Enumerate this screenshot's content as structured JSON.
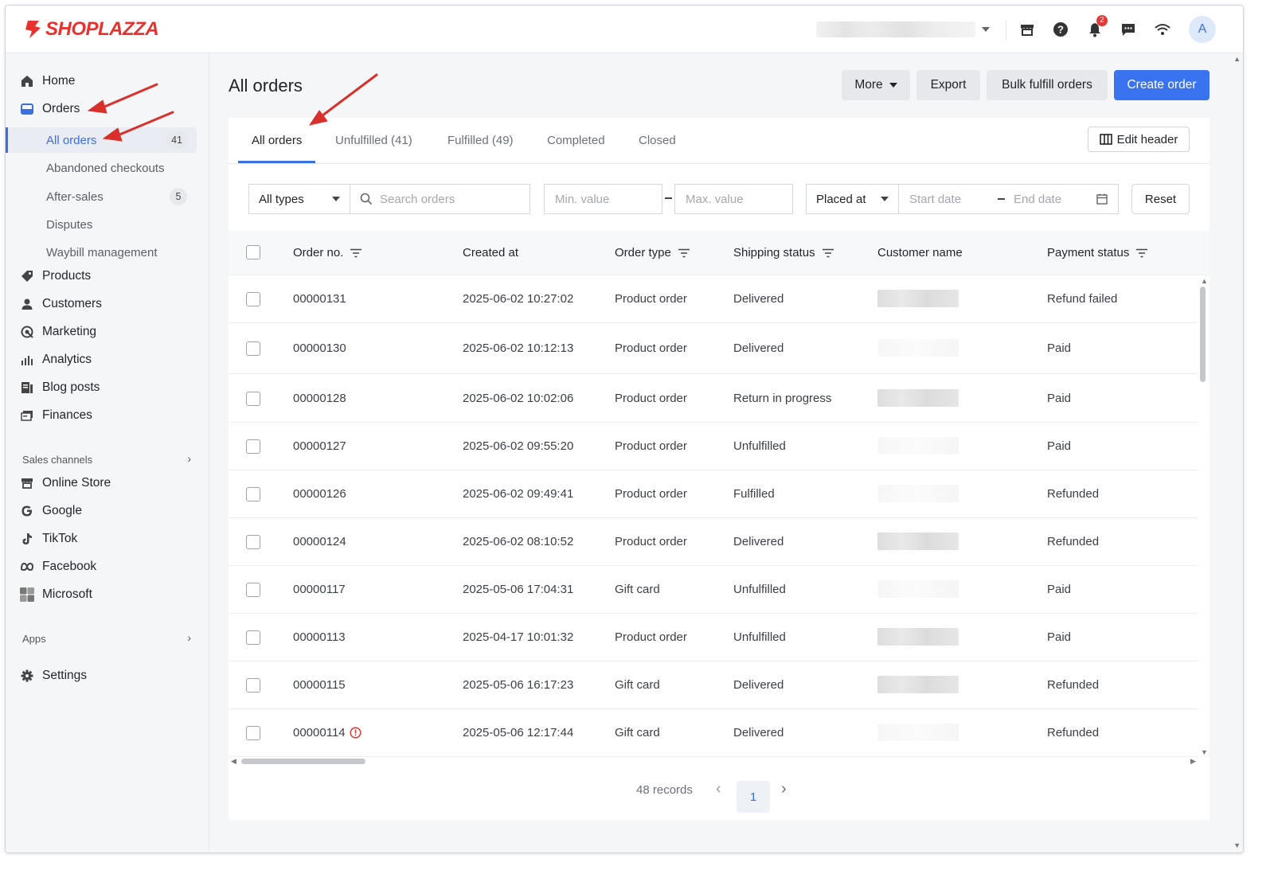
{
  "brand": {
    "name": "SHOPLAZZA",
    "accent": "#e8322e",
    "primary": "#3a73f0"
  },
  "topbar": {
    "notification_count": "2",
    "avatar_letter": "A",
    "icons": [
      "store-icon",
      "help-icon",
      "bell-icon",
      "chat-icon",
      "wifi-icon"
    ]
  },
  "sidebar": {
    "items": [
      {
        "label": "Home",
        "icon": "home-icon"
      },
      {
        "label": "Orders",
        "icon": "orders-icon"
      },
      {
        "label": "Products",
        "icon": "tag-icon"
      },
      {
        "label": "Customers",
        "icon": "person-icon"
      },
      {
        "label": "Marketing",
        "icon": "marketing-icon"
      },
      {
        "label": "Analytics",
        "icon": "bar-chart-icon"
      },
      {
        "label": "Blog posts",
        "icon": "blog-icon"
      },
      {
        "label": "Finances",
        "icon": "finance-icon"
      }
    ],
    "orders_sub": [
      {
        "label": "All orders",
        "count": "41"
      },
      {
        "label": "Abandoned checkouts"
      },
      {
        "label": "After-sales",
        "count": "5"
      },
      {
        "label": "Disputes"
      },
      {
        "label": "Waybill management"
      }
    ],
    "sales_channels_label": "Sales channels",
    "channels": [
      {
        "label": "Online Store",
        "icon": "store-icon"
      },
      {
        "label": "Google",
        "icon": "google-icon"
      },
      {
        "label": "TikTok",
        "icon": "tiktok-icon"
      },
      {
        "label": "Facebook",
        "icon": "meta-icon"
      },
      {
        "label": "Microsoft",
        "icon": "microsoft-icon"
      }
    ],
    "apps_label": "Apps",
    "settings_label": "Settings"
  },
  "page": {
    "title": "All orders",
    "buttons": {
      "more": "More",
      "export": "Export",
      "bulk": "Bulk fulfill orders",
      "create": "Create order"
    }
  },
  "tabs": [
    "All orders",
    "Unfulfilled (41)",
    "Fulfilled (49)",
    "Completed",
    "Closed"
  ],
  "edit_header": "Edit header",
  "filters": {
    "type_value": "All types",
    "search_placeholder": "Search orders",
    "min_placeholder": "Min. value",
    "max_placeholder": "Max. value",
    "date_field": "Placed at",
    "start_placeholder": "Start date",
    "end_placeholder": "End date",
    "reset": "Reset"
  },
  "table": {
    "headers": [
      "Order no.",
      "Created at",
      "Order type",
      "Shipping status",
      "Customer name",
      "Payment status"
    ],
    "rows": [
      {
        "no": "00000131",
        "created": "2025-06-02 10:27:02",
        "type": "Product order",
        "shipping": "Delivered",
        "payment": "Refund failed",
        "alert": false
      },
      {
        "no": "00000130",
        "created": "2025-06-02 10:12:13",
        "type": "Product order",
        "shipping": "Delivered",
        "payment": "Paid",
        "alert": false
      },
      {
        "no": "00000128",
        "created": "2025-06-02 10:02:06",
        "type": "Product order",
        "shipping": "Return in progress",
        "payment": "Paid",
        "alert": false
      },
      {
        "no": "00000127",
        "created": "2025-06-02 09:55:20",
        "type": "Product order",
        "shipping": "Unfulfilled",
        "payment": "Paid",
        "alert": false
      },
      {
        "no": "00000126",
        "created": "2025-06-02 09:49:41",
        "type": "Product order",
        "shipping": "Fulfilled",
        "payment": "Refunded",
        "alert": false
      },
      {
        "no": "00000124",
        "created": "2025-06-02 08:10:52",
        "type": "Product order",
        "shipping": "Delivered",
        "payment": "Refunded",
        "alert": false
      },
      {
        "no": "00000117",
        "created": "2025-05-06 17:04:31",
        "type": "Gift card",
        "shipping": "Unfulfilled",
        "payment": "Paid",
        "alert": false
      },
      {
        "no": "00000113",
        "created": "2025-04-17 10:01:32",
        "type": "Product order",
        "shipping": "Unfulfilled",
        "payment": "Paid",
        "alert": false
      },
      {
        "no": "00000115",
        "created": "2025-05-06 16:17:23",
        "type": "Gift card",
        "shipping": "Delivered",
        "payment": "Refunded",
        "alert": false
      },
      {
        "no": "00000114",
        "created": "2025-05-06 12:17:44",
        "type": "Gift card",
        "shipping": "Delivered",
        "payment": "Refunded",
        "alert": true
      }
    ]
  },
  "pagination": {
    "records": "48 records",
    "current_page": "1"
  }
}
